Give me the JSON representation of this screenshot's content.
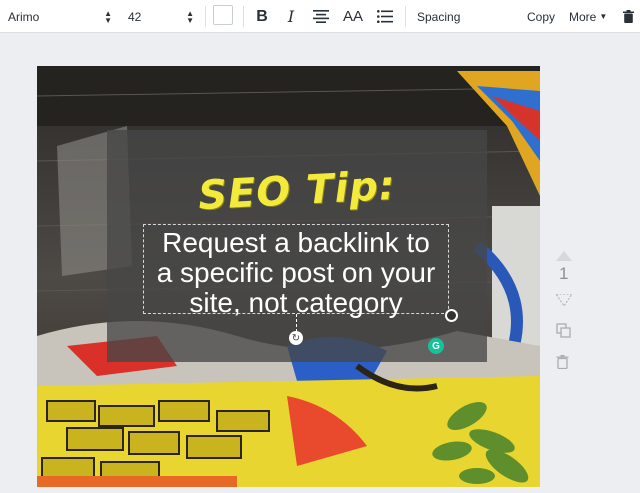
{
  "toolbar": {
    "font_family": "Arimo",
    "font_size": "42",
    "text_color": "#ffffff",
    "bold_label": "B",
    "italic_label": "I",
    "case_label": "AA",
    "spacing_label": "Spacing",
    "copy_label": "Copy",
    "more_label": "More"
  },
  "design": {
    "heading": "SEO Tip:",
    "heading_color": "#f3ea3b",
    "body_lines": [
      "Request a backlink to",
      "a specific post on your",
      "site, not category"
    ],
    "body_color": "#ffffff",
    "overlay_color": "#464646"
  },
  "page_controls": {
    "page_number": "1"
  },
  "icons": [
    "bold-icon",
    "italic-icon",
    "align-center-icon",
    "text-case-icon",
    "list-icon",
    "caret-down-icon",
    "trash-icon",
    "rotate-icon",
    "grammarly-icon",
    "arrow-up-icon",
    "arrow-down-icon",
    "duplicate-icon"
  ]
}
